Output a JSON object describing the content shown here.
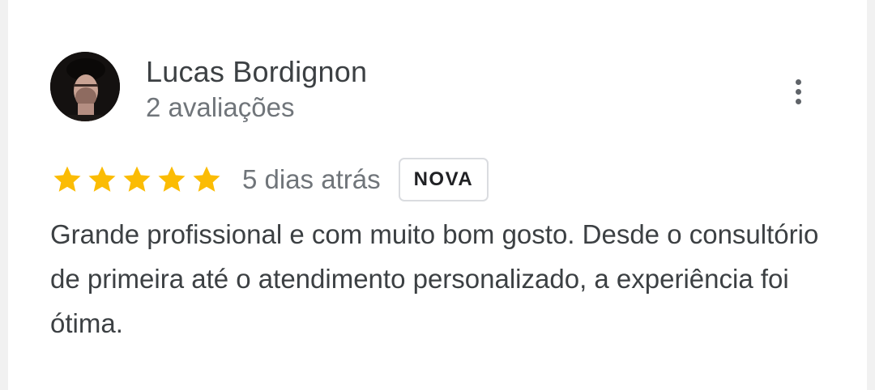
{
  "reviewer": {
    "name": "Lucas Bordignon",
    "reviews_count": "2 avaliações",
    "avatar_icon": "profile-photo"
  },
  "review": {
    "rating": 5,
    "rating_max": 5,
    "time_ago": "5 dias atrás",
    "badge": "NOVA",
    "text": "Grande profissional e com muito bom gosto. Desde o consultório de primeira até o atendimento personalizado, a experiência foi ótima."
  },
  "menu": {
    "icon": "more-vert-icon"
  },
  "colors": {
    "star": "#fbbc04",
    "name": "#3c4043",
    "secondary": "#70757a",
    "badge_border": "#dadce0"
  }
}
